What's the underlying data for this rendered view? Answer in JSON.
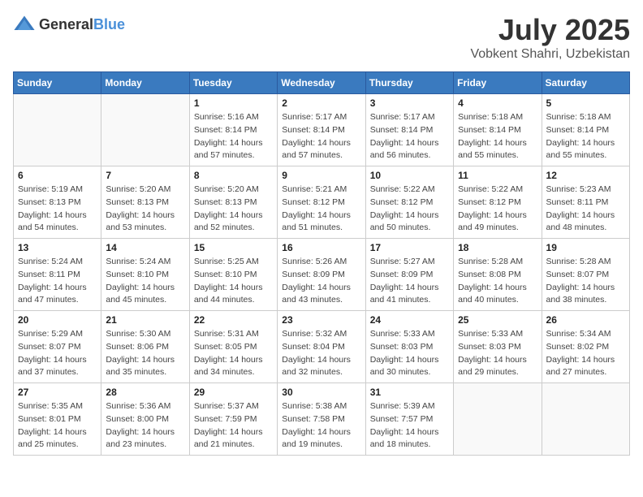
{
  "header": {
    "logo_general": "General",
    "logo_blue": "Blue",
    "month_title": "July 2025",
    "location": "Vobkent Shahri, Uzbekistan"
  },
  "weekdays": [
    "Sunday",
    "Monday",
    "Tuesday",
    "Wednesday",
    "Thursday",
    "Friday",
    "Saturday"
  ],
  "weeks": [
    [
      {
        "day": "",
        "sunrise": "",
        "sunset": "",
        "daylight": ""
      },
      {
        "day": "",
        "sunrise": "",
        "sunset": "",
        "daylight": ""
      },
      {
        "day": "1",
        "sunrise": "Sunrise: 5:16 AM",
        "sunset": "Sunset: 8:14 PM",
        "daylight": "Daylight: 14 hours and 57 minutes."
      },
      {
        "day": "2",
        "sunrise": "Sunrise: 5:17 AM",
        "sunset": "Sunset: 8:14 PM",
        "daylight": "Daylight: 14 hours and 57 minutes."
      },
      {
        "day": "3",
        "sunrise": "Sunrise: 5:17 AM",
        "sunset": "Sunset: 8:14 PM",
        "daylight": "Daylight: 14 hours and 56 minutes."
      },
      {
        "day": "4",
        "sunrise": "Sunrise: 5:18 AM",
        "sunset": "Sunset: 8:14 PM",
        "daylight": "Daylight: 14 hours and 55 minutes."
      },
      {
        "day": "5",
        "sunrise": "Sunrise: 5:18 AM",
        "sunset": "Sunset: 8:14 PM",
        "daylight": "Daylight: 14 hours and 55 minutes."
      }
    ],
    [
      {
        "day": "6",
        "sunrise": "Sunrise: 5:19 AM",
        "sunset": "Sunset: 8:13 PM",
        "daylight": "Daylight: 14 hours and 54 minutes."
      },
      {
        "day": "7",
        "sunrise": "Sunrise: 5:20 AM",
        "sunset": "Sunset: 8:13 PM",
        "daylight": "Daylight: 14 hours and 53 minutes."
      },
      {
        "day": "8",
        "sunrise": "Sunrise: 5:20 AM",
        "sunset": "Sunset: 8:13 PM",
        "daylight": "Daylight: 14 hours and 52 minutes."
      },
      {
        "day": "9",
        "sunrise": "Sunrise: 5:21 AM",
        "sunset": "Sunset: 8:12 PM",
        "daylight": "Daylight: 14 hours and 51 minutes."
      },
      {
        "day": "10",
        "sunrise": "Sunrise: 5:22 AM",
        "sunset": "Sunset: 8:12 PM",
        "daylight": "Daylight: 14 hours and 50 minutes."
      },
      {
        "day": "11",
        "sunrise": "Sunrise: 5:22 AM",
        "sunset": "Sunset: 8:12 PM",
        "daylight": "Daylight: 14 hours and 49 minutes."
      },
      {
        "day": "12",
        "sunrise": "Sunrise: 5:23 AM",
        "sunset": "Sunset: 8:11 PM",
        "daylight": "Daylight: 14 hours and 48 minutes."
      }
    ],
    [
      {
        "day": "13",
        "sunrise": "Sunrise: 5:24 AM",
        "sunset": "Sunset: 8:11 PM",
        "daylight": "Daylight: 14 hours and 47 minutes."
      },
      {
        "day": "14",
        "sunrise": "Sunrise: 5:24 AM",
        "sunset": "Sunset: 8:10 PM",
        "daylight": "Daylight: 14 hours and 45 minutes."
      },
      {
        "day": "15",
        "sunrise": "Sunrise: 5:25 AM",
        "sunset": "Sunset: 8:10 PM",
        "daylight": "Daylight: 14 hours and 44 minutes."
      },
      {
        "day": "16",
        "sunrise": "Sunrise: 5:26 AM",
        "sunset": "Sunset: 8:09 PM",
        "daylight": "Daylight: 14 hours and 43 minutes."
      },
      {
        "day": "17",
        "sunrise": "Sunrise: 5:27 AM",
        "sunset": "Sunset: 8:09 PM",
        "daylight": "Daylight: 14 hours and 41 minutes."
      },
      {
        "day": "18",
        "sunrise": "Sunrise: 5:28 AM",
        "sunset": "Sunset: 8:08 PM",
        "daylight": "Daylight: 14 hours and 40 minutes."
      },
      {
        "day": "19",
        "sunrise": "Sunrise: 5:28 AM",
        "sunset": "Sunset: 8:07 PM",
        "daylight": "Daylight: 14 hours and 38 minutes."
      }
    ],
    [
      {
        "day": "20",
        "sunrise": "Sunrise: 5:29 AM",
        "sunset": "Sunset: 8:07 PM",
        "daylight": "Daylight: 14 hours and 37 minutes."
      },
      {
        "day": "21",
        "sunrise": "Sunrise: 5:30 AM",
        "sunset": "Sunset: 8:06 PM",
        "daylight": "Daylight: 14 hours and 35 minutes."
      },
      {
        "day": "22",
        "sunrise": "Sunrise: 5:31 AM",
        "sunset": "Sunset: 8:05 PM",
        "daylight": "Daylight: 14 hours and 34 minutes."
      },
      {
        "day": "23",
        "sunrise": "Sunrise: 5:32 AM",
        "sunset": "Sunset: 8:04 PM",
        "daylight": "Daylight: 14 hours and 32 minutes."
      },
      {
        "day": "24",
        "sunrise": "Sunrise: 5:33 AM",
        "sunset": "Sunset: 8:03 PM",
        "daylight": "Daylight: 14 hours and 30 minutes."
      },
      {
        "day": "25",
        "sunrise": "Sunrise: 5:33 AM",
        "sunset": "Sunset: 8:03 PM",
        "daylight": "Daylight: 14 hours and 29 minutes."
      },
      {
        "day": "26",
        "sunrise": "Sunrise: 5:34 AM",
        "sunset": "Sunset: 8:02 PM",
        "daylight": "Daylight: 14 hours and 27 minutes."
      }
    ],
    [
      {
        "day": "27",
        "sunrise": "Sunrise: 5:35 AM",
        "sunset": "Sunset: 8:01 PM",
        "daylight": "Daylight: 14 hours and 25 minutes."
      },
      {
        "day": "28",
        "sunrise": "Sunrise: 5:36 AM",
        "sunset": "Sunset: 8:00 PM",
        "daylight": "Daylight: 14 hours and 23 minutes."
      },
      {
        "day": "29",
        "sunrise": "Sunrise: 5:37 AM",
        "sunset": "Sunset: 7:59 PM",
        "daylight": "Daylight: 14 hours and 21 minutes."
      },
      {
        "day": "30",
        "sunrise": "Sunrise: 5:38 AM",
        "sunset": "Sunset: 7:58 PM",
        "daylight": "Daylight: 14 hours and 19 minutes."
      },
      {
        "day": "31",
        "sunrise": "Sunrise: 5:39 AM",
        "sunset": "Sunset: 7:57 PM",
        "daylight": "Daylight: 14 hours and 18 minutes."
      },
      {
        "day": "",
        "sunrise": "",
        "sunset": "",
        "daylight": ""
      },
      {
        "day": "",
        "sunrise": "",
        "sunset": "",
        "daylight": ""
      }
    ]
  ]
}
